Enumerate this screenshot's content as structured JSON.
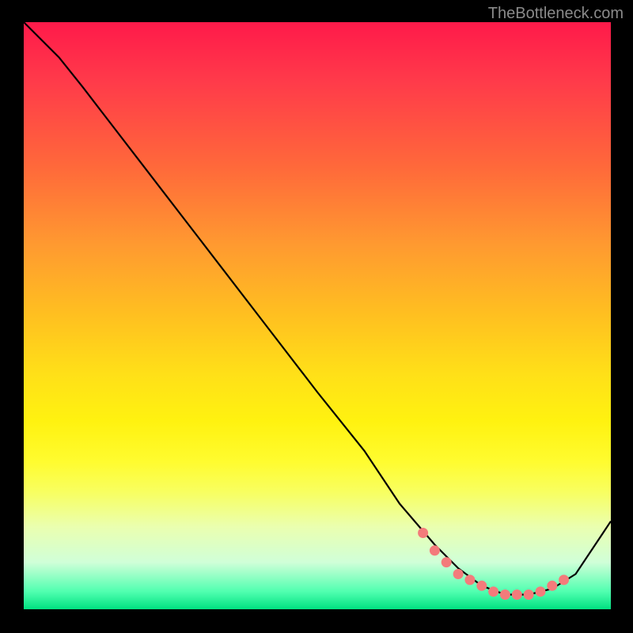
{
  "attribution": "TheBottleneck.com",
  "chart_data": {
    "type": "line",
    "title": "",
    "xlabel": "",
    "ylabel": "",
    "xlim": [
      0,
      100
    ],
    "ylim": [
      0,
      100
    ],
    "series": [
      {
        "name": "curve",
        "x": [
          0,
          6,
          10,
          20,
          30,
          40,
          50,
          58,
          64,
          70,
          74,
          78,
          82,
          86,
          90,
          94,
          100
        ],
        "y": [
          100,
          94,
          89,
          76,
          63,
          50,
          37,
          27,
          18,
          11,
          7,
          4,
          2.5,
          2.5,
          3.5,
          6,
          15
        ]
      }
    ],
    "markers": {
      "name": "dotted-segment",
      "x": [
        68,
        70,
        72,
        74,
        76,
        78,
        80,
        82,
        84,
        86,
        88,
        90,
        92
      ],
      "y": [
        13,
        10,
        8,
        6,
        5,
        4,
        3,
        2.5,
        2.5,
        2.5,
        3,
        4,
        5
      ]
    },
    "gradient_stops": [
      {
        "pos": 0.0,
        "color": "#ff1a4a"
      },
      {
        "pos": 0.5,
        "color": "#ffe018"
      },
      {
        "pos": 0.97,
        "color": "#50ffb0"
      },
      {
        "pos": 1.0,
        "color": "#00e080"
      }
    ]
  }
}
